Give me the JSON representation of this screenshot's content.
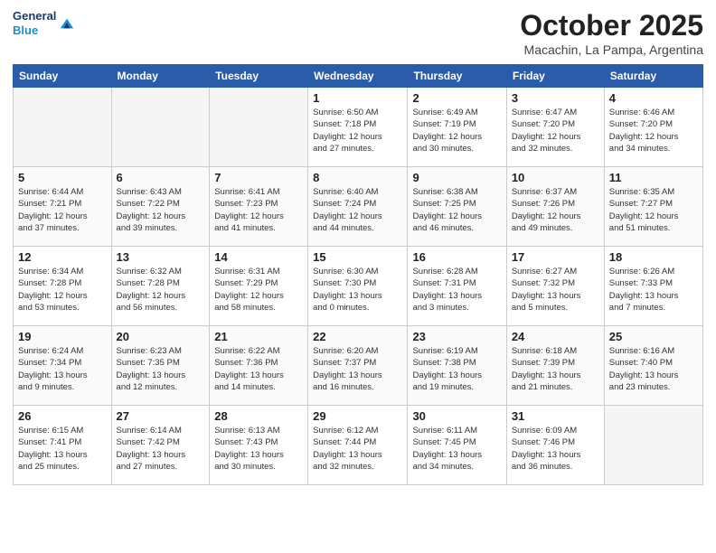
{
  "header": {
    "logo": {
      "line1": "General",
      "line2": "Blue"
    },
    "title": "October 2025",
    "subtitle": "Macachin, La Pampa, Argentina"
  },
  "weekdays": [
    "Sunday",
    "Monday",
    "Tuesday",
    "Wednesday",
    "Thursday",
    "Friday",
    "Saturday"
  ],
  "weeks": [
    [
      {
        "day": "",
        "info": ""
      },
      {
        "day": "",
        "info": ""
      },
      {
        "day": "",
        "info": ""
      },
      {
        "day": "1",
        "info": "Sunrise: 6:50 AM\nSunset: 7:18 PM\nDaylight: 12 hours\nand 27 minutes."
      },
      {
        "day": "2",
        "info": "Sunrise: 6:49 AM\nSunset: 7:19 PM\nDaylight: 12 hours\nand 30 minutes."
      },
      {
        "day": "3",
        "info": "Sunrise: 6:47 AM\nSunset: 7:20 PM\nDaylight: 12 hours\nand 32 minutes."
      },
      {
        "day": "4",
        "info": "Sunrise: 6:46 AM\nSunset: 7:20 PM\nDaylight: 12 hours\nand 34 minutes."
      }
    ],
    [
      {
        "day": "5",
        "info": "Sunrise: 6:44 AM\nSunset: 7:21 PM\nDaylight: 12 hours\nand 37 minutes."
      },
      {
        "day": "6",
        "info": "Sunrise: 6:43 AM\nSunset: 7:22 PM\nDaylight: 12 hours\nand 39 minutes."
      },
      {
        "day": "7",
        "info": "Sunrise: 6:41 AM\nSunset: 7:23 PM\nDaylight: 12 hours\nand 41 minutes."
      },
      {
        "day": "8",
        "info": "Sunrise: 6:40 AM\nSunset: 7:24 PM\nDaylight: 12 hours\nand 44 minutes."
      },
      {
        "day": "9",
        "info": "Sunrise: 6:38 AM\nSunset: 7:25 PM\nDaylight: 12 hours\nand 46 minutes."
      },
      {
        "day": "10",
        "info": "Sunrise: 6:37 AM\nSunset: 7:26 PM\nDaylight: 12 hours\nand 49 minutes."
      },
      {
        "day": "11",
        "info": "Sunrise: 6:35 AM\nSunset: 7:27 PM\nDaylight: 12 hours\nand 51 minutes."
      }
    ],
    [
      {
        "day": "12",
        "info": "Sunrise: 6:34 AM\nSunset: 7:28 PM\nDaylight: 12 hours\nand 53 minutes."
      },
      {
        "day": "13",
        "info": "Sunrise: 6:32 AM\nSunset: 7:28 PM\nDaylight: 12 hours\nand 56 minutes."
      },
      {
        "day": "14",
        "info": "Sunrise: 6:31 AM\nSunset: 7:29 PM\nDaylight: 12 hours\nand 58 minutes."
      },
      {
        "day": "15",
        "info": "Sunrise: 6:30 AM\nSunset: 7:30 PM\nDaylight: 13 hours\nand 0 minutes."
      },
      {
        "day": "16",
        "info": "Sunrise: 6:28 AM\nSunset: 7:31 PM\nDaylight: 13 hours\nand 3 minutes."
      },
      {
        "day": "17",
        "info": "Sunrise: 6:27 AM\nSunset: 7:32 PM\nDaylight: 13 hours\nand 5 minutes."
      },
      {
        "day": "18",
        "info": "Sunrise: 6:26 AM\nSunset: 7:33 PM\nDaylight: 13 hours\nand 7 minutes."
      }
    ],
    [
      {
        "day": "19",
        "info": "Sunrise: 6:24 AM\nSunset: 7:34 PM\nDaylight: 13 hours\nand 9 minutes."
      },
      {
        "day": "20",
        "info": "Sunrise: 6:23 AM\nSunset: 7:35 PM\nDaylight: 13 hours\nand 12 minutes."
      },
      {
        "day": "21",
        "info": "Sunrise: 6:22 AM\nSunset: 7:36 PM\nDaylight: 13 hours\nand 14 minutes."
      },
      {
        "day": "22",
        "info": "Sunrise: 6:20 AM\nSunset: 7:37 PM\nDaylight: 13 hours\nand 16 minutes."
      },
      {
        "day": "23",
        "info": "Sunrise: 6:19 AM\nSunset: 7:38 PM\nDaylight: 13 hours\nand 19 minutes."
      },
      {
        "day": "24",
        "info": "Sunrise: 6:18 AM\nSunset: 7:39 PM\nDaylight: 13 hours\nand 21 minutes."
      },
      {
        "day": "25",
        "info": "Sunrise: 6:16 AM\nSunset: 7:40 PM\nDaylight: 13 hours\nand 23 minutes."
      }
    ],
    [
      {
        "day": "26",
        "info": "Sunrise: 6:15 AM\nSunset: 7:41 PM\nDaylight: 13 hours\nand 25 minutes."
      },
      {
        "day": "27",
        "info": "Sunrise: 6:14 AM\nSunset: 7:42 PM\nDaylight: 13 hours\nand 27 minutes."
      },
      {
        "day": "28",
        "info": "Sunrise: 6:13 AM\nSunset: 7:43 PM\nDaylight: 13 hours\nand 30 minutes."
      },
      {
        "day": "29",
        "info": "Sunrise: 6:12 AM\nSunset: 7:44 PM\nDaylight: 13 hours\nand 32 minutes."
      },
      {
        "day": "30",
        "info": "Sunrise: 6:11 AM\nSunset: 7:45 PM\nDaylight: 13 hours\nand 34 minutes."
      },
      {
        "day": "31",
        "info": "Sunrise: 6:09 AM\nSunset: 7:46 PM\nDaylight: 13 hours\nand 36 minutes."
      },
      {
        "day": "",
        "info": ""
      }
    ]
  ]
}
